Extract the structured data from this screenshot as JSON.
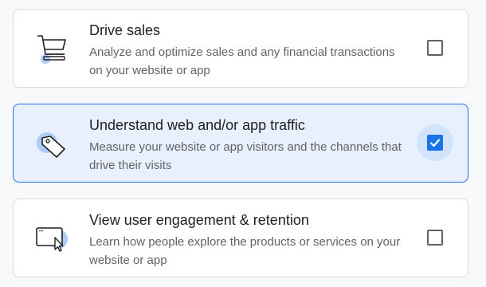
{
  "options": [
    {
      "title": "Drive sales",
      "description": "Analyze and optimize sales and any financial transactions on your website or app",
      "icon": "shopping-cart-icon",
      "checked": false
    },
    {
      "title": "Understand web and/or app traffic",
      "description": "Measure your website or app visitors and the channels that drive their visits",
      "icon": "tag-icon",
      "checked": true
    },
    {
      "title": "View user engagement & retention",
      "description": "Learn how people explore the products or services on your website or app",
      "icon": "browser-cursor-icon",
      "checked": false
    }
  ],
  "colors": {
    "accent": "#1a73e8",
    "selected_background": "#e8f0fe",
    "check_halo": "#d2e3fc",
    "icon_accent": "#aecbfa",
    "title_text": "#202124",
    "body_text": "#5f6368",
    "border": "#dadce0"
  }
}
